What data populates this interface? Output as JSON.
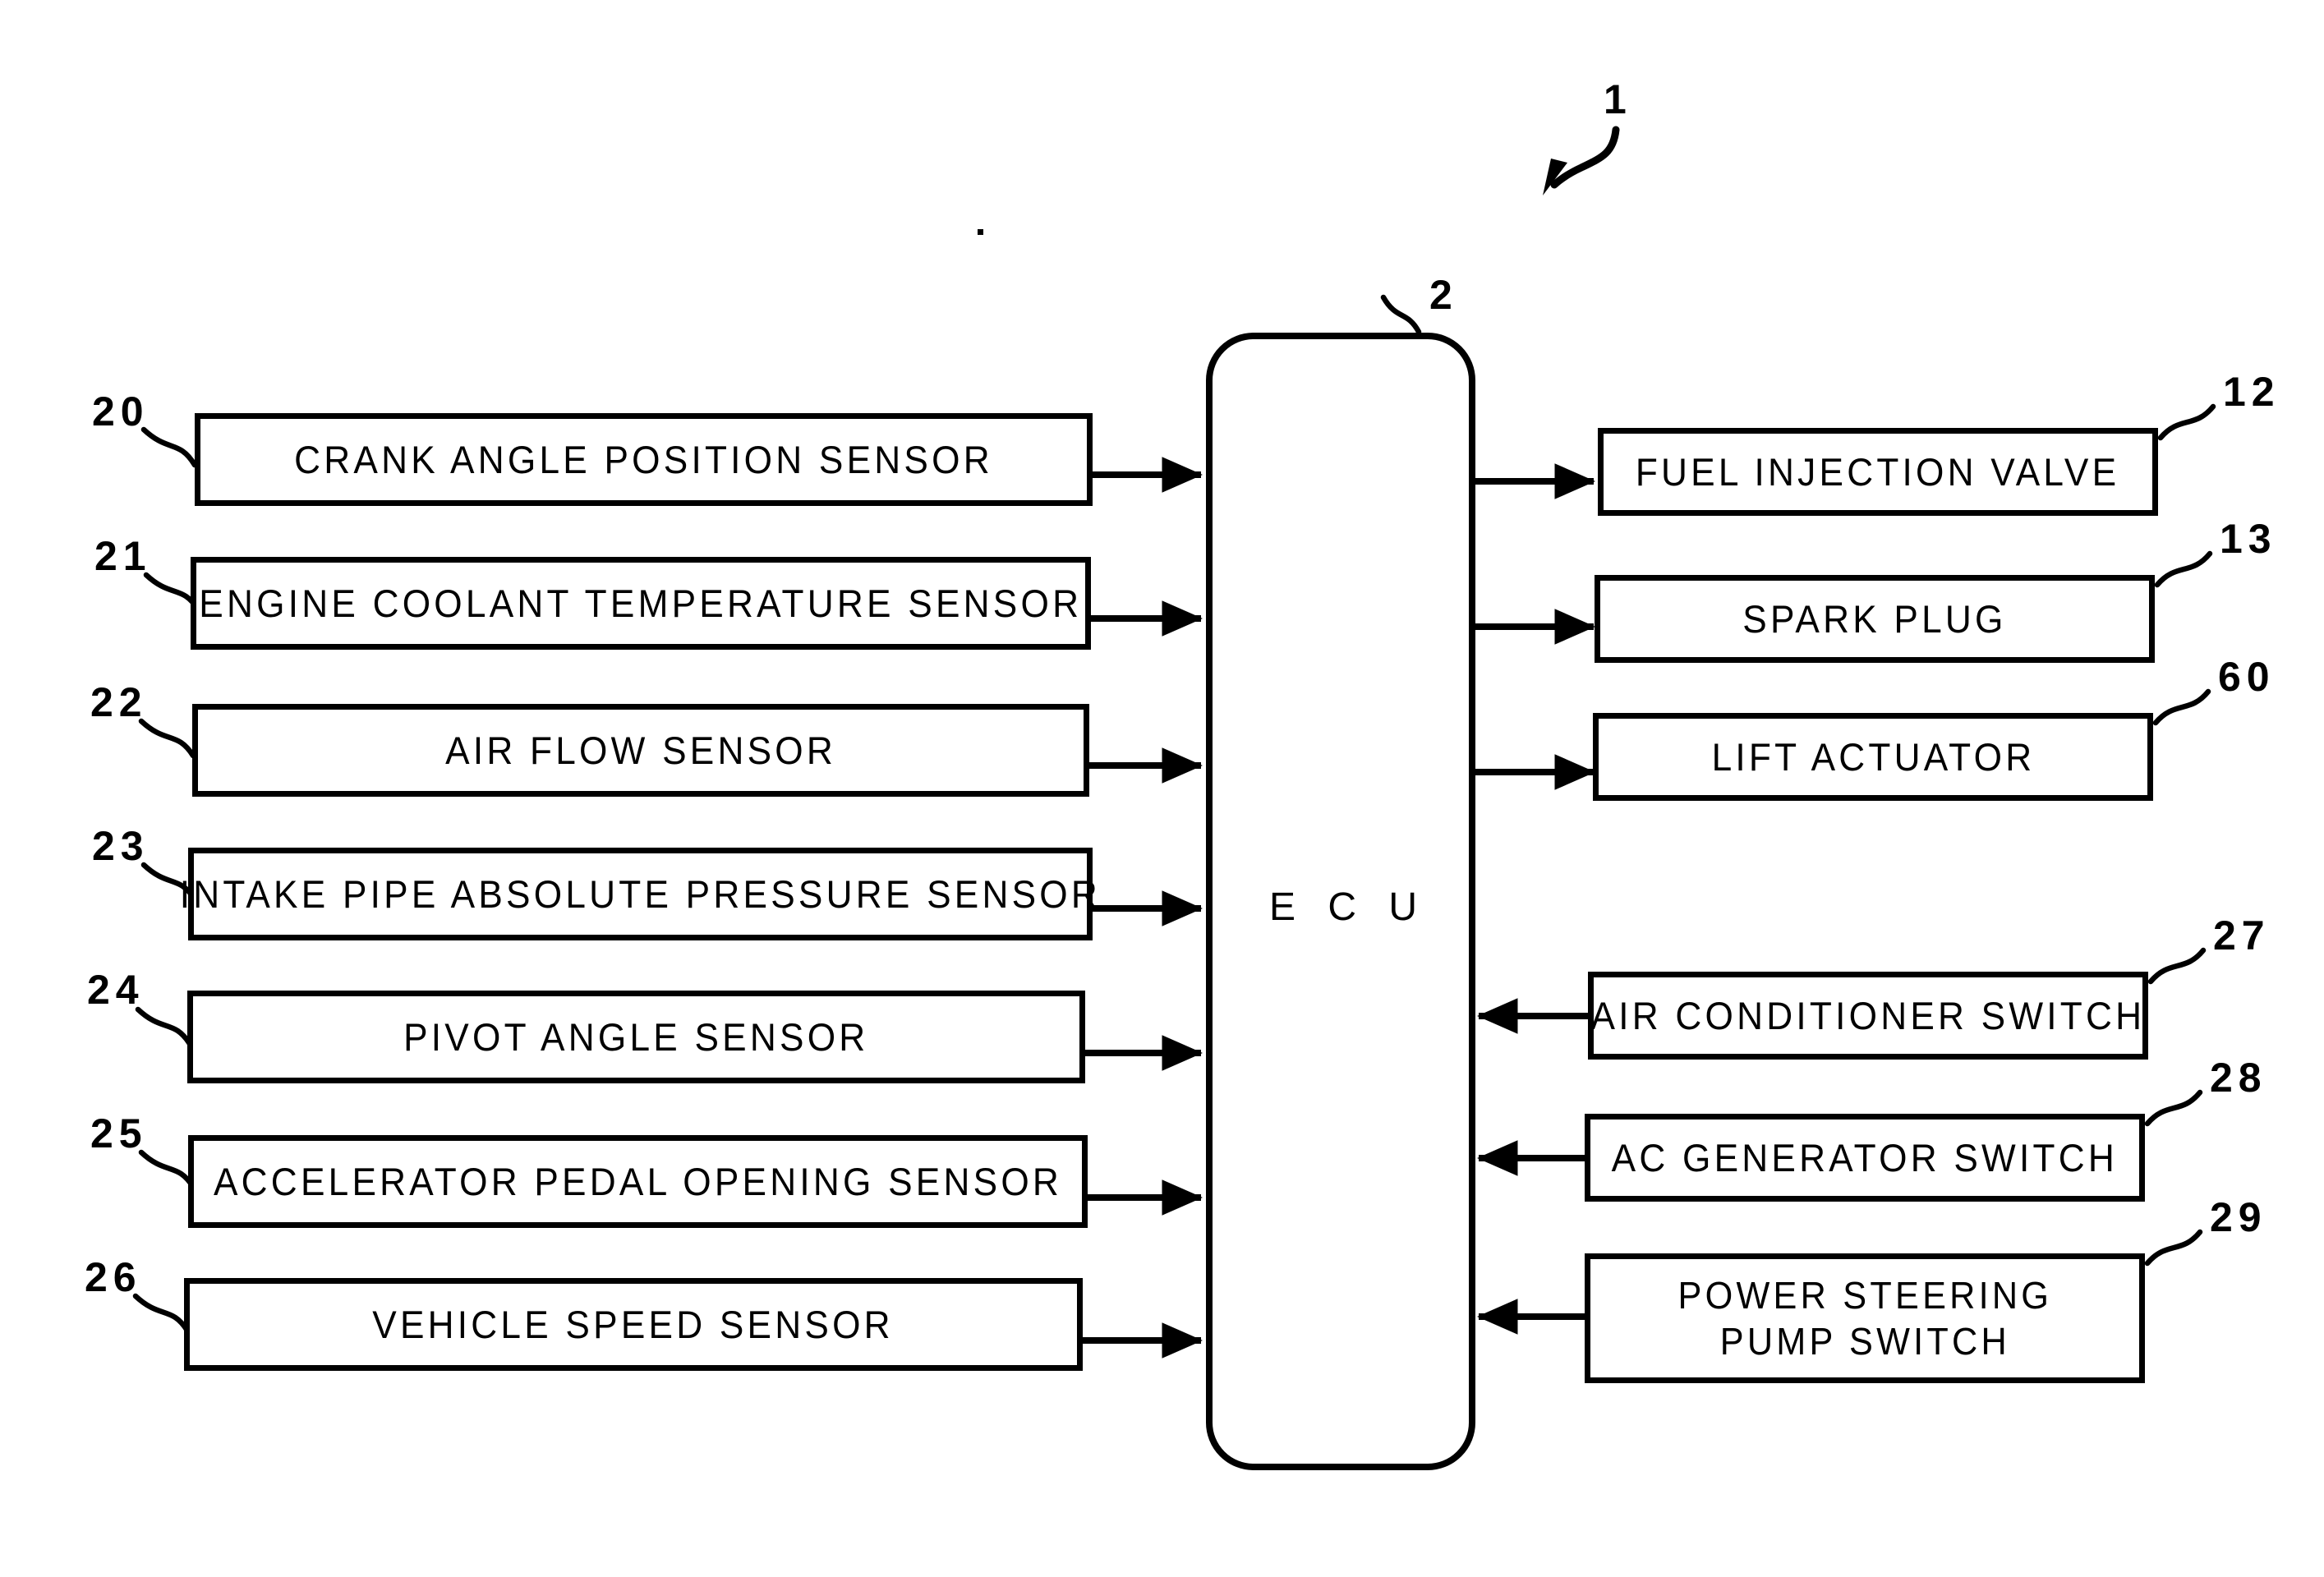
{
  "figure": {
    "system_ref": "1",
    "controller": {
      "ref": "2",
      "label": "E C U"
    },
    "inputs": [
      {
        "ref": "20",
        "label": "CRANK ANGLE POSITION SENSOR"
      },
      {
        "ref": "21",
        "label": "ENGINE COOLANT TEMPERATURE SENSOR"
      },
      {
        "ref": "22",
        "label": "AIR FLOW SENSOR"
      },
      {
        "ref": "23",
        "label": "INTAKE PIPE ABSOLUTE PRESSURE SENSOR"
      },
      {
        "ref": "24",
        "label": "PIVOT ANGLE SENSOR"
      },
      {
        "ref": "25",
        "label": "ACCELERATOR PEDAL OPENING SENSOR"
      },
      {
        "ref": "26",
        "label": "VEHICLE SPEED SENSOR"
      }
    ],
    "outputs": [
      {
        "ref": "12",
        "label": "FUEL INJECTION VALVE"
      },
      {
        "ref": "13",
        "label": "SPARK PLUG"
      },
      {
        "ref": "60",
        "label": "LIFT ACTUATOR"
      }
    ],
    "switches": [
      {
        "ref": "27",
        "label": "AIR CONDITIONER SWITCH"
      },
      {
        "ref": "28",
        "label": "AC GENERATOR SWITCH"
      },
      {
        "ref": "29",
        "label_line1": "POWER STEERING",
        "label_line2": "PUMP SWITCH"
      }
    ],
    "colors": {
      "ink": "#000000",
      "paper": "#ffffff"
    }
  }
}
